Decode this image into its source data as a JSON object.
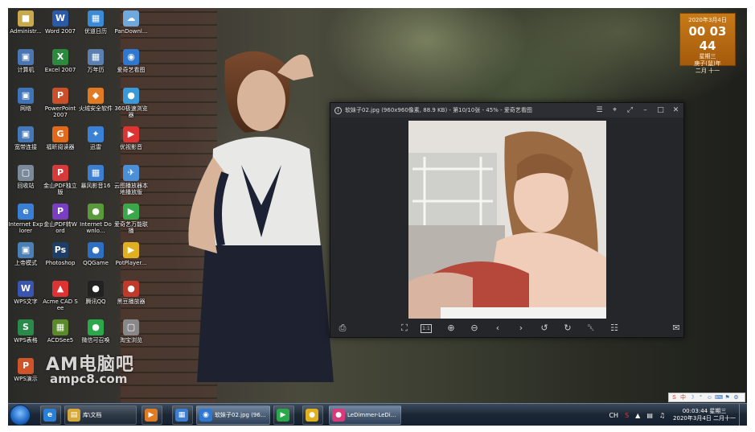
{
  "desktop": {
    "icons": [
      {
        "label": "Administr...",
        "color": "#c9a94c",
        "glyph": "■"
      },
      {
        "label": "Word 2007",
        "color": "#2b5aa8",
        "glyph": "W"
      },
      {
        "label": "优道日历",
        "color": "#3a8ad8",
        "glyph": "▦"
      },
      {
        "label": "PanDownl...",
        "color": "#6fa8dc",
        "glyph": "☁"
      },
      {
        "label": "计算机",
        "color": "#4a77b4",
        "glyph": "▣"
      },
      {
        "label": "Excel 2007",
        "color": "#2b8a3e",
        "glyph": "X"
      },
      {
        "label": "万年历",
        "color": "#5a7fb0",
        "glyph": "▦"
      },
      {
        "label": "爱奇艺看图",
        "color": "#2e78d1",
        "glyph": "◉"
      },
      {
        "label": "网络",
        "color": "#3f74b8",
        "glyph": "▣"
      },
      {
        "label": "PowerPoint 2007",
        "color": "#c9502a",
        "glyph": "P"
      },
      {
        "label": "火绒安全软件",
        "color": "#e07b24",
        "glyph": "◆"
      },
      {
        "label": "360极速浏览器",
        "color": "#3a9ad9",
        "glyph": "●"
      },
      {
        "label": "宽带连接",
        "color": "#4478b8",
        "glyph": "▣"
      },
      {
        "label": "福昕阅读器",
        "color": "#e06a1a",
        "glyph": "G"
      },
      {
        "label": "迅雷",
        "color": "#3b82d6",
        "glyph": "✦"
      },
      {
        "label": "优视影音",
        "color": "#d33",
        "glyph": "▶"
      },
      {
        "label": "回收站",
        "color": "#7a8a9a",
        "glyph": "▢"
      },
      {
        "label": "金山PDF独立版",
        "color": "#d63a3a",
        "glyph": "P"
      },
      {
        "label": "暴风影音16",
        "color": "#3c7fd0",
        "glyph": "▦"
      },
      {
        "label": "云图播放器本地播放版",
        "color": "#4a8fd8",
        "glyph": "✈"
      },
      {
        "label": "Internet Explorer",
        "color": "#3a7fd6",
        "glyph": "e"
      },
      {
        "label": "金山PDF转Word",
        "color": "#7a3fc0",
        "glyph": "P"
      },
      {
        "label": "Internet Downlo...",
        "color": "#5a9a3a",
        "glyph": "●"
      },
      {
        "label": "爱奇艺万能联播",
        "color": "#3aa84a",
        "glyph": "▶"
      },
      {
        "label": "上帝模式",
        "color": "#4a7fb8",
        "glyph": "▣"
      },
      {
        "label": "Photoshop",
        "color": "#1d3e66",
        "glyph": "Ps"
      },
      {
        "label": "QQGame",
        "color": "#2e6fc4",
        "glyph": "●"
      },
      {
        "label": "PotPlayer...",
        "color": "#e0b020",
        "glyph": "▶"
      },
      {
        "label": "WPS文字",
        "color": "#3a55b0",
        "glyph": "W"
      },
      {
        "label": "Acme CAD See",
        "color": "#d33",
        "glyph": "▲"
      },
      {
        "label": "腾讯QQ",
        "color": "#222",
        "glyph": "●"
      },
      {
        "label": "黑豆播放器",
        "color": "#c0392b",
        "glyph": "●"
      },
      {
        "label": "WPS表格",
        "color": "#2a8a4a",
        "glyph": "S"
      },
      {
        "label": "ACDSee5",
        "color": "#5b8a2a",
        "glyph": "▦"
      },
      {
        "label": "微信可召唤",
        "color": "#2aa84a",
        "glyph": "●"
      },
      {
        "label": "淘宝浏览",
        "color": "#888",
        "glyph": "▢"
      },
      {
        "label": "WPS演示",
        "color": "#d0542a",
        "glyph": "P"
      },
      {
        "label": "",
        "color": "#555",
        "glyph": ""
      },
      {
        "label": "",
        "color": "#555",
        "glyph": ""
      },
      {
        "label": "",
        "color": "#555",
        "glyph": ""
      }
    ]
  },
  "clock_gadget": {
    "date": "2020年3月4日",
    "time": "00 03 44",
    "weekday": "星期三",
    "lunar_year": "庚子(鼠)年",
    "lunar_day": "二月 十一"
  },
  "viewer": {
    "title": "软妹子02.jpg (960x960像素, 88.9 KB) - 第10/10张 - 45% - 爱奇艺看图",
    "title_buttons": [
      "☰",
      "⌖",
      "⤢",
      "–",
      "□",
      "✕"
    ],
    "bottom_buttons": [
      {
        "name": "print-icon",
        "glyph": "⎙"
      },
      {
        "name": "crop-icon",
        "glyph": "⛶"
      },
      {
        "name": "actual-size-icon",
        "glyph": "1:1"
      },
      {
        "name": "zoom-in-icon",
        "glyph": "⊕"
      },
      {
        "name": "zoom-out-icon",
        "glyph": "⊖"
      },
      {
        "name": "previous-icon",
        "glyph": "‹"
      },
      {
        "name": "next-icon",
        "glyph": "›"
      },
      {
        "name": "rotate-left-icon",
        "glyph": "↺"
      },
      {
        "name": "rotate-right-icon",
        "glyph": "↻"
      },
      {
        "name": "delete-icon",
        "glyph": "␡"
      },
      {
        "name": "thumbnails-icon",
        "glyph": "☷"
      },
      {
        "name": "feedback-icon",
        "glyph": "✉"
      }
    ]
  },
  "watermark": {
    "line1": "AM电脑吧",
    "line2": "ampc8.com"
  },
  "ime_bar": [
    "S",
    "中",
    "☽",
    "°",
    "☺",
    "⌨",
    "⚑",
    "⚙"
  ],
  "taskbar": {
    "items": [
      {
        "label": "",
        "color": "#2a7fd6",
        "glyph": "e"
      },
      {
        "label": "库\\文档",
        "color": "#d4a83a",
        "glyph": "▤"
      },
      {
        "label": "",
        "color": "#e07b24",
        "glyph": "▶"
      },
      {
        "label": "",
        "color": "#3c7fd0",
        "glyph": "▦"
      },
      {
        "label": "软妹子02.jpg (96...",
        "color": "#2e78d1",
        "glyph": "◉"
      },
      {
        "label": "",
        "color": "#2aa84a",
        "glyph": "▶"
      },
      {
        "label": "",
        "color": "#e0b020",
        "glyph": "●"
      },
      {
        "label": "LeDimmer-LeDi...",
        "color": "#d83a7a",
        "glyph": "●"
      }
    ],
    "tray": {
      "lang": "CH",
      "time": "00:03:44 星期三",
      "date": "2020年3月4日 二月十一"
    }
  }
}
